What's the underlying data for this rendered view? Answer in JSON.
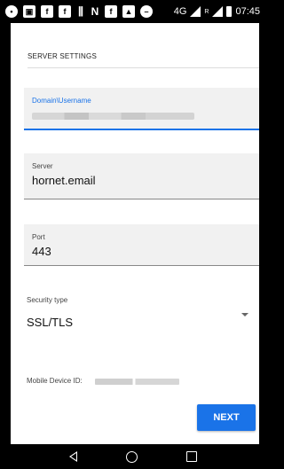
{
  "status_bar": {
    "network": "4G",
    "roaming": "R",
    "time": "07:45",
    "icons": [
      "message-icon",
      "gallery-icon",
      "app-icon",
      "app-icon",
      "signal-bars-icon",
      "nfc-icon",
      "app-icon",
      "image-icon",
      "do-not-disturb-icon"
    ]
  },
  "page": {
    "header": "SERVER SETTINGS"
  },
  "fields": {
    "domain_username": {
      "label": "Domain\\Username",
      "value": ""
    },
    "server": {
      "label": "Server",
      "value": "hornet.email"
    },
    "port": {
      "label": "Port",
      "value": "443"
    }
  },
  "security": {
    "label": "Security type",
    "value": "SSL/TLS"
  },
  "device": {
    "label": "Mobile Device ID:"
  },
  "actions": {
    "next_label": "NEXT"
  },
  "colors": {
    "accent": "#1a73e8",
    "field_bg": "#f1f1f1"
  }
}
